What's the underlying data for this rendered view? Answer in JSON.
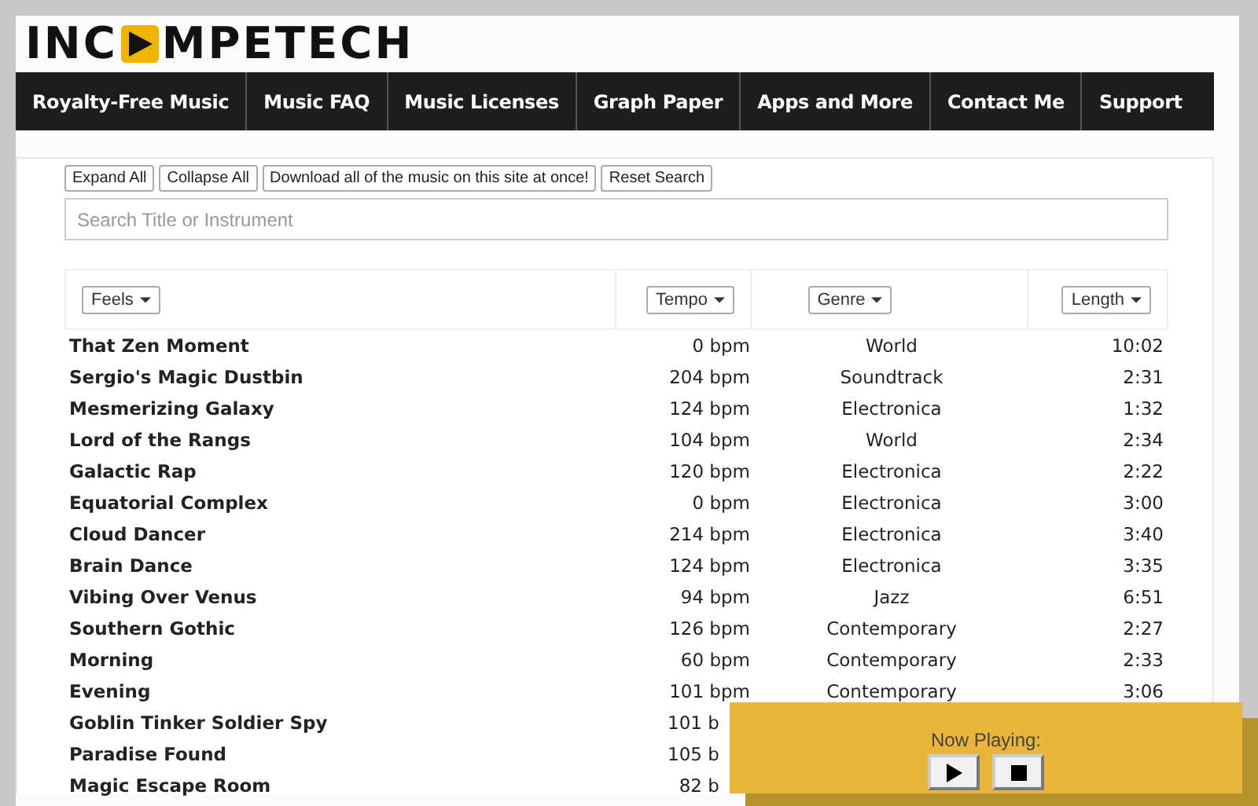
{
  "logo": {
    "left": "INC",
    "right": "MPETECH"
  },
  "nav": [
    "Royalty-Free Music",
    "Music FAQ",
    "Music Licenses",
    "Graph Paper",
    "Apps and More",
    "Contact Me",
    "Support"
  ],
  "buttons": [
    "Expand All",
    "Collapse All",
    "Download all of the music on this site at once!",
    "Reset Search"
  ],
  "search": {
    "placeholder": "Search Title or Instrument"
  },
  "filters": [
    "Feels",
    "Tempo",
    "Genre",
    "Length"
  ],
  "rows": [
    {
      "title": "That Zen Moment",
      "tempo": "0 bpm",
      "genre": "World",
      "length": "10:02"
    },
    {
      "title": "Sergio's Magic Dustbin",
      "tempo": "204 bpm",
      "genre": "Soundtrack",
      "length": "2:31"
    },
    {
      "title": "Mesmerizing Galaxy",
      "tempo": "124 bpm",
      "genre": "Electronica",
      "length": "1:32"
    },
    {
      "title": "Lord of the Rangs",
      "tempo": "104 bpm",
      "genre": "World",
      "length": "2:34"
    },
    {
      "title": "Galactic Rap",
      "tempo": "120 bpm",
      "genre": "Electronica",
      "length": "2:22"
    },
    {
      "title": "Equatorial Complex",
      "tempo": "0 bpm",
      "genre": "Electronica",
      "length": "3:00"
    },
    {
      "title": "Cloud Dancer",
      "tempo": "214 bpm",
      "genre": "Electronica",
      "length": "3:40"
    },
    {
      "title": "Brain Dance",
      "tempo": "124 bpm",
      "genre": "Electronica",
      "length": "3:35"
    },
    {
      "title": "Vibing Over Venus",
      "tempo": "94 bpm",
      "genre": "Jazz",
      "length": "6:51"
    },
    {
      "title": "Southern Gothic",
      "tempo": "126 bpm",
      "genre": "Contemporary",
      "length": "2:27"
    },
    {
      "title": "Morning",
      "tempo": "60 bpm",
      "genre": "Contemporary",
      "length": "2:33"
    },
    {
      "title": "Evening",
      "tempo": "101 bpm",
      "genre": "Contemporary",
      "length": "3:06"
    },
    {
      "title": "Goblin Tinker Soldier Spy",
      "tempo": "101 b"
    },
    {
      "title": "Paradise Found",
      "tempo": "105 b"
    },
    {
      "title": "Magic Escape Room",
      "tempo": "82 b"
    }
  ],
  "player": {
    "label": "Now Playing:"
  }
}
